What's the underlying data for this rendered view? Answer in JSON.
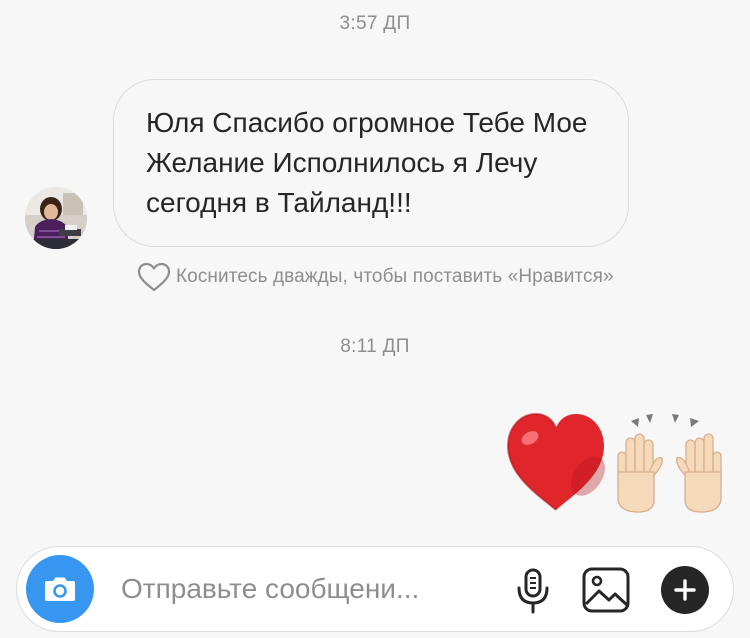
{
  "thread": {
    "timestamps": [
      "3:57 ДП",
      "8:11 ДП"
    ],
    "incoming_message": {
      "text": "Юля Спасибо огромное Тебе Мое Желание Исполнилось я Лечу сегодня в Тайланд!!!",
      "like_hint": "Коснитесь дважды, чтобы поставить «Нравится»"
    },
    "outgoing_message": {
      "emoji": [
        "red-heart",
        "raising-hands"
      ]
    }
  },
  "composer": {
    "placeholder": "Отправьте сообщени...",
    "value": "",
    "icons": {
      "camera": "camera-icon",
      "mic": "microphone-icon",
      "gallery": "gallery-icon",
      "plus": "plus-icon"
    }
  },
  "colors": {
    "background": "#f7f7f7",
    "bubble_border": "#dbdbdb",
    "secondary_text": "#8e8e8e",
    "camera_button": "#3797f0",
    "plus_button": "#262626",
    "heart": "#e0262b"
  }
}
